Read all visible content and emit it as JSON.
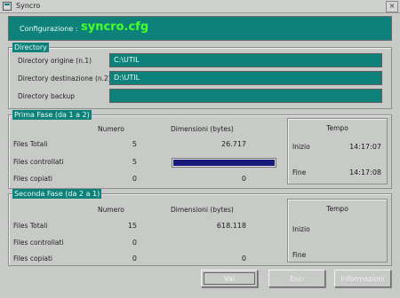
{
  "window": {
    "title": "Syncro",
    "close_label": "×"
  },
  "config": {
    "label": "Configurazione :",
    "value": "syncro.cfg"
  },
  "directory": {
    "group_label": "Directory",
    "rows": [
      {
        "label": "Directory origine (n.1)",
        "value": "C:\\UTIL"
      },
      {
        "label": "Directory destinazione (n.2)",
        "value": "D:\\UTIL"
      },
      {
        "label": "Directory backup",
        "value": ""
      }
    ]
  },
  "phase1": {
    "group_label": "Prima Fase (da 1 a 2)",
    "col_numero": "Numero",
    "col_dimensioni": "Dimensioni (bytes)",
    "rows": [
      {
        "label": "Files Totali",
        "numero": "5",
        "dimensioni": "26.717"
      },
      {
        "label": "Files controllati",
        "numero": "5",
        "dimensioni": ""
      },
      {
        "label": "Files copiati",
        "numero": "0",
        "dimensioni": "0"
      }
    ],
    "progress": 1.0,
    "time": {
      "header": "Tempo",
      "start_label": "Inizio",
      "start": "14:17:07",
      "end_label": "Fine",
      "end": "14:17:08"
    }
  },
  "phase2": {
    "group_label": "Seconda Fase (da 2 a 1)",
    "col_numero": "Numero",
    "col_dimensioni": "Dimensioni (bytes)",
    "rows": [
      {
        "label": "Files Totali",
        "numero": "15",
        "dimensioni": "618.118"
      },
      {
        "label": "Files controllati",
        "numero": "0",
        "dimensioni": ""
      },
      {
        "label": "Files copiati",
        "numero": "0",
        "dimensioni": "0"
      }
    ],
    "time": {
      "header": "Tempo",
      "start_label": "Inizio",
      "start": "",
      "end_label": "Fine",
      "end": ""
    }
  },
  "buttons": {
    "ok": "Vai",
    "exit": "Esci",
    "info": "Informazioni"
  },
  "colors": {
    "accent": "#0e827a",
    "config_value": "#45ff29",
    "progress": "#1a1a7a"
  }
}
